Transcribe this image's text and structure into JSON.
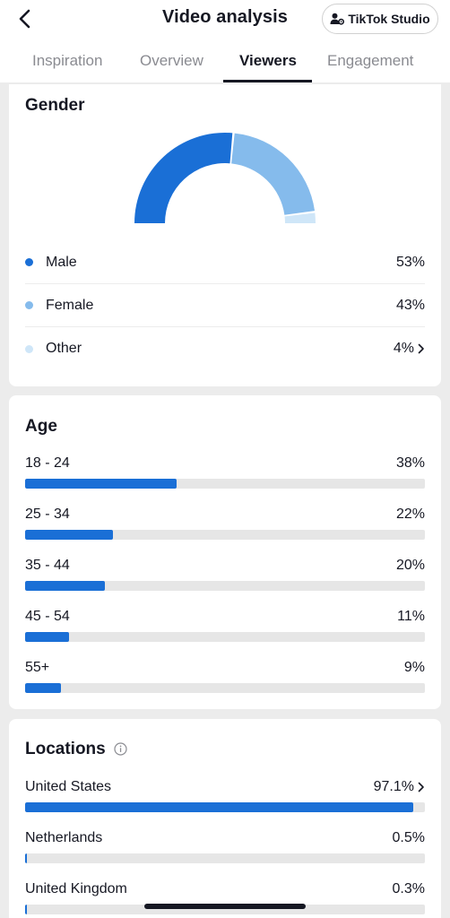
{
  "header": {
    "title": "Video analysis",
    "studio_label": "TikTok Studio"
  },
  "tabs": [
    {
      "label": "Inspiration"
    },
    {
      "label": "Overview"
    },
    {
      "label": "Viewers"
    },
    {
      "label": "Engagement"
    }
  ],
  "active_tab": "Viewers",
  "gender": {
    "title": "Gender",
    "items": [
      {
        "label": "Male",
        "value": "53%",
        "percent": 53,
        "color": "#1a6fd6"
      },
      {
        "label": "Female",
        "value": "43%",
        "percent": 43,
        "color": "#85bbec"
      },
      {
        "label": "Other",
        "value": "4%",
        "percent": 4,
        "color": "#cfe6f8"
      }
    ]
  },
  "age": {
    "title": "Age",
    "items": [
      {
        "label": "18 - 24",
        "value": "38%",
        "percent": 38
      },
      {
        "label": "25 - 34",
        "value": "22%",
        "percent": 22
      },
      {
        "label": "35 - 44",
        "value": "20%",
        "percent": 20
      },
      {
        "label": "45 - 54",
        "value": "11%",
        "percent": 11
      },
      {
        "label": "55+",
        "value": "9%",
        "percent": 9
      }
    ]
  },
  "locations": {
    "title": "Locations",
    "items": [
      {
        "label": "United States",
        "value": "97.1%",
        "percent": 97.1
      },
      {
        "label": "Netherlands",
        "value": "0.5%",
        "percent": 0.5
      },
      {
        "label": "United Kingdom",
        "value": "0.3%",
        "percent": 0.3
      }
    ]
  },
  "colors": {
    "bar": "#1a6fd6",
    "track": "#e6e6e6"
  }
}
